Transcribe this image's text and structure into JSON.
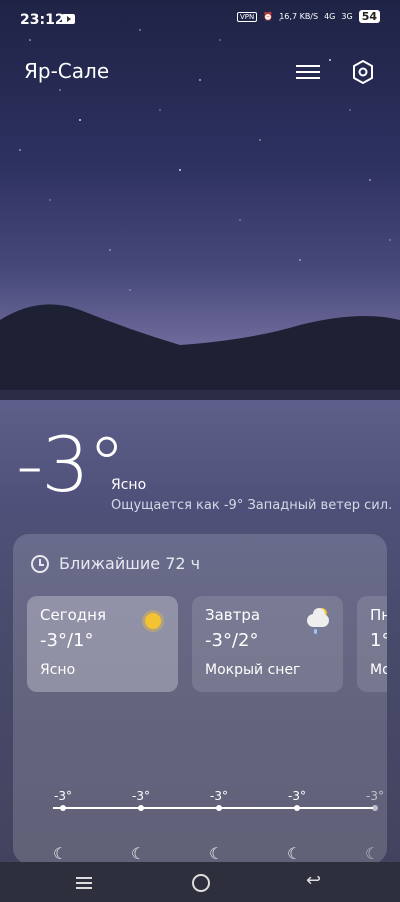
{
  "status": {
    "time": "23:12",
    "vpn": "VPN",
    "speed": "16,7 KB/S",
    "net1": "4G",
    "net2": "3G",
    "battery": "54"
  },
  "header": {
    "city": "Яр-Сале"
  },
  "current": {
    "temperature": "-3°",
    "condition": "Ясно",
    "feels_like": "Ощущается как -9° Западный ветер сил."
  },
  "forecast": {
    "title": "Ближайшие 72 ч",
    "days": [
      {
        "name": "Сегодня",
        "temp": "-3°/1°",
        "cond": "Ясно",
        "icon": "sun-icon"
      },
      {
        "name": "Завтра",
        "temp": "-3°/2°",
        "cond": "Мокрый снег",
        "icon": "sleet-icon"
      },
      {
        "name": "Пн",
        "temp": "1°",
        "cond": "Мо",
        "icon": "sun-icon"
      }
    ],
    "hourly": [
      "-3°",
      "-3°",
      "-3°",
      "-3°",
      "-3°"
    ]
  },
  "colors": {
    "sun": "#f4c334",
    "card": "rgba(255,255,255,0.16)"
  }
}
